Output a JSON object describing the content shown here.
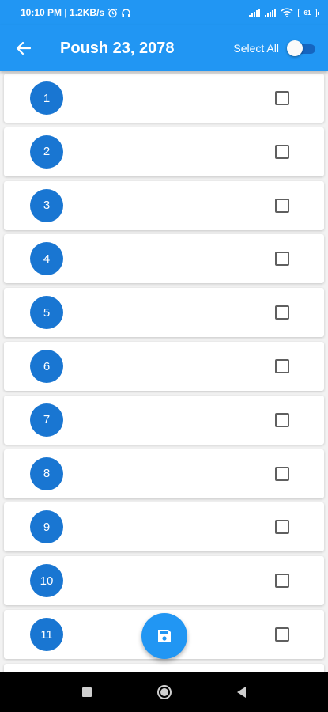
{
  "status_bar": {
    "time_info": "10:10 PM | 1.2KB/s",
    "battery": "61",
    "icons": [
      "alarm-icon",
      "headphones-icon",
      "signal-icon",
      "signal-icon",
      "wifi-icon",
      "battery-icon"
    ]
  },
  "app_bar": {
    "title": "Poush 23, 2078",
    "select_all_label": "Select All",
    "select_all_on": false,
    "back_icon": "arrow-back-icon"
  },
  "list": {
    "items": [
      {
        "number": "1",
        "checked": false
      },
      {
        "number": "2",
        "checked": false
      },
      {
        "number": "3",
        "checked": false
      },
      {
        "number": "4",
        "checked": false
      },
      {
        "number": "5",
        "checked": false
      },
      {
        "number": "6",
        "checked": false
      },
      {
        "number": "7",
        "checked": false
      },
      {
        "number": "8",
        "checked": false
      },
      {
        "number": "9",
        "checked": false
      },
      {
        "number": "10",
        "checked": false
      },
      {
        "number": "11",
        "checked": false
      }
    ]
  },
  "fab": {
    "icon": "save-icon"
  },
  "nav_bar": {
    "icons": [
      "recents-icon",
      "home-icon",
      "back-icon"
    ]
  },
  "colors": {
    "primary": "#2196f3",
    "number_circle": "#1976d2",
    "toggle_track": "#1565c0"
  }
}
